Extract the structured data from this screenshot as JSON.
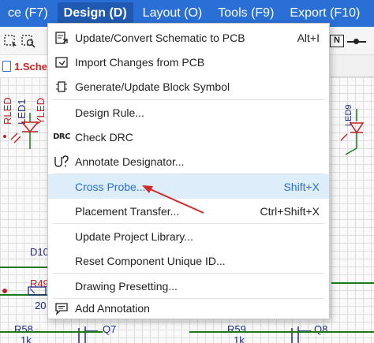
{
  "menubar": {
    "items": [
      {
        "label": "ce (F7)",
        "active": false
      },
      {
        "label": "Design (D)",
        "active": true
      },
      {
        "label": "Layout (O)",
        "active": false
      },
      {
        "label": "Tools (F9)",
        "active": false
      },
      {
        "label": "Export (F10)",
        "active": false
      }
    ]
  },
  "toolbar": {
    "icons": [
      "select-box-icon",
      "zoom-area-icon"
    ],
    "net_label": "N"
  },
  "tab": {
    "label": "1.Sche"
  },
  "canvas": {
    "labels": {
      "rled": "RLED",
      "led1": "LED1",
      "yled": "YLED",
      "led9": "LED9",
      "d10": "D10",
      "r49": "R49",
      "n20": "20",
      "r58": "R58",
      "r58_val": "1k",
      "q7": "Q7",
      "r59": "R59",
      "r59_val": "1k",
      "q8": "Q8"
    },
    "colors": {
      "wire": "#1b7a1b",
      "designator": "#1f2a8a",
      "net": "#c02020"
    }
  },
  "dropdown": {
    "items": [
      {
        "label": "Update/Convert Schematic to PCB",
        "shortcut": "Alt+I",
        "icon": "update-pcb-icon"
      },
      {
        "label": "Import Changes from PCB",
        "shortcut": "",
        "icon": "import-changes-icon"
      },
      {
        "label": "Generate/Update Block Symbol",
        "shortcut": "",
        "icon": "block-symbol-icon"
      },
      {
        "label": "Design Rule...",
        "shortcut": "",
        "icon": ""
      },
      {
        "label": "Check DRC",
        "shortcut": "",
        "icon": "drc-icon",
        "icon_text": "DRC"
      },
      {
        "label": "Annotate Designator...",
        "shortcut": "",
        "icon": "annotate-icon"
      },
      {
        "label": "Cross Probe...",
        "shortcut": "Shift+X",
        "icon": "",
        "highlighted": true
      },
      {
        "label": "Placement Transfer...",
        "shortcut": "Ctrl+Shift+X",
        "icon": ""
      },
      {
        "label": "Update Project Library...",
        "shortcut": "",
        "icon": ""
      },
      {
        "label": "Reset Component Unique ID...",
        "shortcut": "",
        "icon": ""
      },
      {
        "label": "Drawing Presetting...",
        "shortcut": "",
        "icon": ""
      },
      {
        "label": "Add Annotation",
        "shortcut": "",
        "icon": "annotation-icon"
      }
    ]
  },
  "annotation": {
    "arrow_color": "#d42a2a",
    "points_to": "Cross Probe..."
  }
}
